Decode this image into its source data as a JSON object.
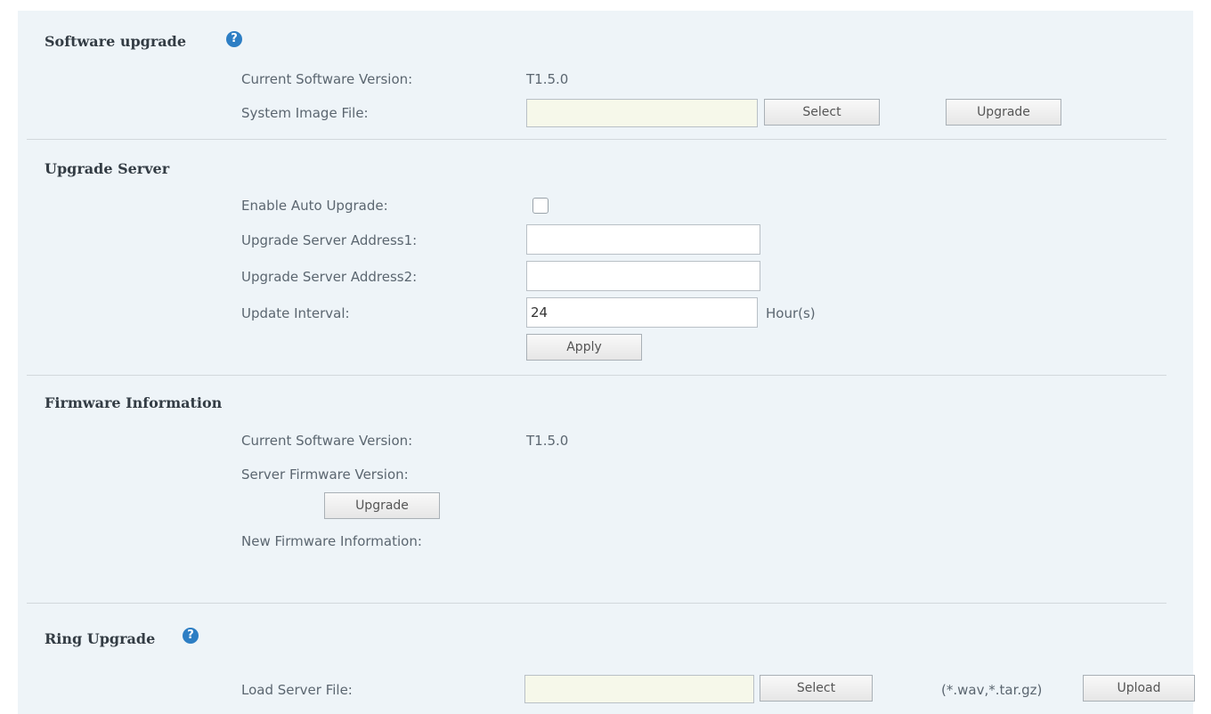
{
  "software_upgrade": {
    "title": "Software upgrade",
    "help_icon": "?",
    "current_version_label": "Current Software Version:",
    "current_version_value": "T1.5.0",
    "system_image_label": "System Image File:",
    "system_image_value": "",
    "select_label": "Select",
    "upgrade_label": "Upgrade"
  },
  "upgrade_server": {
    "title": "Upgrade Server",
    "enable_auto_label": "Enable Auto Upgrade:",
    "enable_auto_checked": false,
    "address1_label": "Upgrade Server Address1:",
    "address1_value": "",
    "address2_label": "Upgrade Server Address2:",
    "address2_value": "",
    "interval_label": "Update Interval:",
    "interval_value": "24",
    "interval_unit": "Hour(s)",
    "apply_label": "Apply"
  },
  "firmware_info": {
    "title": "Firmware Information",
    "current_version_label": "Current Software Version:",
    "current_version_value": "T1.5.0",
    "server_version_label": "Server Firmware Version:",
    "upgrade_label": "Upgrade",
    "new_info_label": "New Firmware Information:"
  },
  "ring_upgrade": {
    "title": "Ring Upgrade",
    "help_icon": "?",
    "load_label": "Load Server File:",
    "load_value": "",
    "select_label": "Select",
    "file_types": "(*.wav,*.tar.gz)",
    "upload_label": "Upload"
  }
}
